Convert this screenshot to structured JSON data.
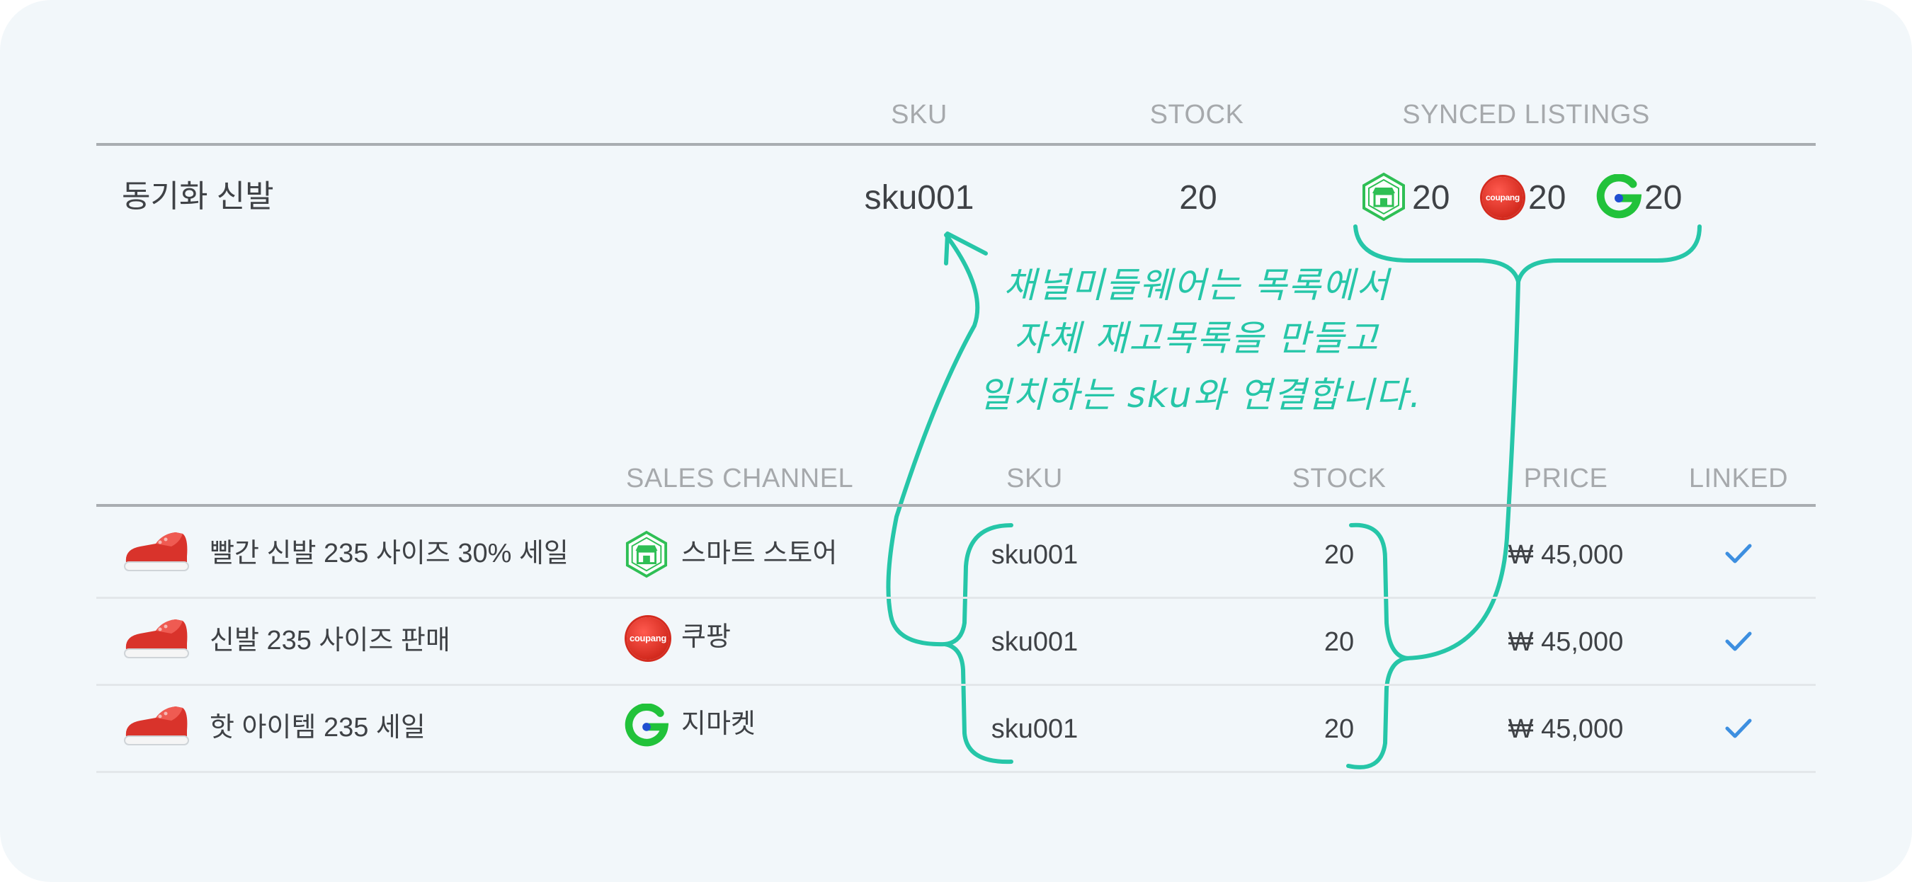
{
  "summary": {
    "headers": {
      "sku": "SKU",
      "stock": "STOCK",
      "synced_listings": "SYNCED LISTINGS"
    },
    "product_name": "동기화 신발",
    "sku": "sku001",
    "stock": "20",
    "synced": [
      {
        "channel_icon": "smartstore-icon",
        "count": "20"
      },
      {
        "channel_icon": "coupang-icon",
        "count": "20"
      },
      {
        "channel_icon": "gmarket-icon",
        "count": "20"
      }
    ]
  },
  "annotation": {
    "lines": [
      "채널미들웨어는 목록에서",
      "자체 재고목록을 만들고",
      "일치하는 sku와 연결합니다."
    ],
    "color": "#26c6a8"
  },
  "listings": {
    "headers": {
      "sales_channel": "SALES CHANNEL",
      "sku": "SKU",
      "stock": "STOCK",
      "price": "PRICE",
      "linked": "LINKED"
    },
    "rows": [
      {
        "title": "빨간 신발 235 사이즈 30% 세일",
        "channel": "스마트 스토어",
        "channel_icon": "smartstore-icon",
        "sku": "sku001",
        "stock": "20",
        "price": "₩ 45,000",
        "linked": true
      },
      {
        "title": "신발 235 사이즈 판매",
        "channel": "쿠팡",
        "channel_icon": "coupang-icon",
        "sku": "sku001",
        "stock": "20",
        "price": "₩ 45,000",
        "linked": true
      },
      {
        "title": "핫 아이템 235 세일",
        "channel": "지마켓",
        "channel_icon": "gmarket-icon",
        "sku": "sku001",
        "stock": "20",
        "price": "₩ 45,000",
        "linked": true
      }
    ]
  },
  "icons": {
    "coupang_label": "coupang",
    "check_color": "#3d8fe0",
    "smartstore_color": "#2fbf55",
    "coupang_color": "#d42b1f",
    "gmarket_color": "#21c23a"
  }
}
